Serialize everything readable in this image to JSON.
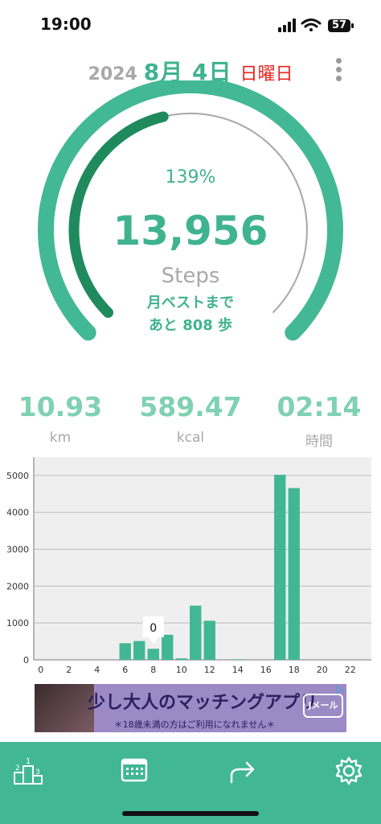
{
  "status_bar": {
    "time": "19:00",
    "battery": "57"
  },
  "header": {
    "year": "2024",
    "month_day": "8月 4日",
    "weekday": "日曜日"
  },
  "gauge": {
    "percent_text": "139%",
    "steps": "13,956",
    "steps_unit": "Steps",
    "monthly_best_line1": "月ベストまで",
    "monthly_best_line2": "あと 808 歩",
    "progress_fraction": 1.0,
    "best_progress_fraction": 0.45,
    "colors": {
      "outer": "#43b894",
      "inner": "#1f8a5e",
      "track": "#a8a8a8"
    }
  },
  "stats": [
    {
      "value": "10.93",
      "unit": "km"
    },
    {
      "value": "589.47",
      "unit": "kcal"
    },
    {
      "value": "02:14",
      "unit": "時間"
    }
  ],
  "chart_data": {
    "type": "bar",
    "x": [
      6,
      7,
      8,
      9,
      10,
      11,
      12,
      14,
      17,
      18
    ],
    "values": [
      450,
      510,
      300,
      680,
      40,
      1470,
      1060,
      15,
      5020,
      4660
    ],
    "xticks": [
      "0",
      "2",
      "4",
      "6",
      "8",
      "10",
      "12",
      "14",
      "16",
      "18",
      "20",
      "22"
    ],
    "yticks": [
      "0",
      "1000",
      "2000",
      "3000",
      "4000",
      "5000"
    ],
    "xlim": [
      -0.5,
      23.5
    ],
    "ylim": [
      0,
      5500
    ],
    "tooltip": {
      "x": 8,
      "text": "0"
    },
    "bar_color": "#41b794",
    "grid": true
  },
  "ad": {
    "title": "少し大人のマッチングアプリ",
    "note": "＊18歳未満の方はご利用になれません＊",
    "logo": "Jメール"
  },
  "tabbar": {
    "color": "#41b794",
    "icons": [
      "ranking-icon",
      "calendar-icon",
      "share-icon",
      "settings-icon"
    ]
  }
}
